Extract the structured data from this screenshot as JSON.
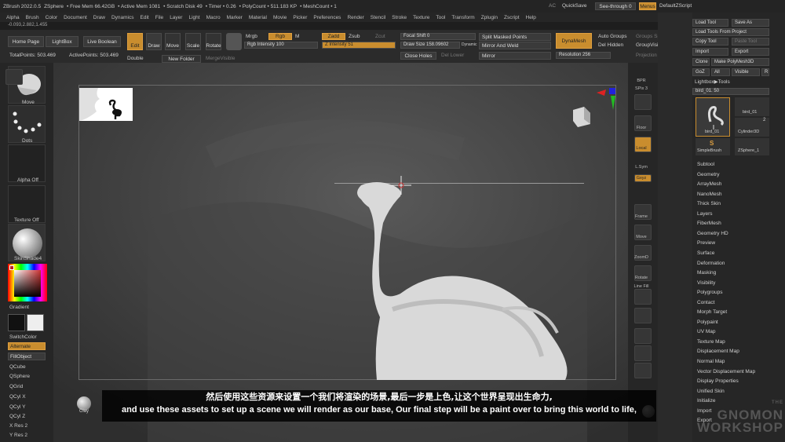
{
  "titlebar": {
    "items": [
      "ZBrush 2022.0.5",
      "ZSphere",
      "• Free Mem 66.42GB",
      "• Active Mem 1081",
      "• Scratch Disk 49",
      "• Timer • 0.26",
      "• PolyCount • 511.183 KP",
      "• MeshCount • 1"
    ],
    "ac": "AC",
    "quicksave": "QuickSave",
    "seethrough": "See-through  0",
    "menus": "Menus",
    "script": "DefaultZScript"
  },
  "menubar": [
    "Alpha",
    "Brush",
    "Color",
    "Document",
    "Draw",
    "Dynamics",
    "Edit",
    "File",
    "Layer",
    "Light",
    "Macro",
    "Marker",
    "Material",
    "Movie",
    "Picker",
    "Preferences",
    "Render",
    "Stencil",
    "Stroke",
    "Texture",
    "Tool",
    "Transform",
    "Zplugin",
    "Zscript",
    "Help"
  ],
  "coords": "-0.093,2.882,1.455",
  "toolrow": {
    "home": "Home Page",
    "lightbox": "LightBox",
    "liveboolean": "Live Boolean",
    "edit": "Edit",
    "draw": "Draw",
    "move": "Move",
    "scale": "Scale",
    "rotate": "Rotate",
    "mrgb": "Mrgb",
    "rgb": "Rgb",
    "m": "M",
    "rgb_intensity": "Rgb Intensity 100",
    "zadd": "Zadd",
    "zsub": "Zsub",
    "zcut": "Zcut",
    "z_intensity": "Z Intensity 51",
    "focal_shift": "Focal Shift 0",
    "draw_size": "Draw Size 158.09602",
    "dynamic": "Dynamic",
    "close_holes": "Close Holes",
    "del_lower": "Del Lower",
    "split_masked": "Split Masked Points",
    "mirror_weld": "Mirror And Weld",
    "mirror": "Mirror",
    "dynamesh": "DynaMesh",
    "resolution": "Resolution 256",
    "auto_groups": "Auto Groups",
    "del_hidden": "Del Hidden",
    "groups_split": "Groups Split",
    "group_visible": "GroupVisible",
    "projection_shell": "Projection Shell",
    "totalpoints": "TotalPoints: 503.469",
    "activepoints": "ActivePoints: 503.469",
    "double": "Double",
    "new_folder": "New Folder",
    "merge_visible": "MergeVisible"
  },
  "leftshelf": {
    "move": "Move",
    "dots": "Dots",
    "alpha_off": "Alpha Off",
    "texture_off": "Texture Off",
    "skinshade": "SkinShade4",
    "gradient": "Gradient",
    "switchcolor": "SwitchColor",
    "alternate": "Alternate",
    "fillobject": "FillObject",
    "qcube": "QCube",
    "qsphere": "QSphere",
    "qgrid": "QGrid",
    "qcylx": "QCyl X",
    "qcyly": "QCyl Y",
    "qcylz": "QCyl Z",
    "xres": "X Res 2",
    "yres": "Y Res 2"
  },
  "bottomshelf": {
    "clay": "Clay",
    "move": "Move",
    "backfacemask": "BackfaceMask",
    "accucurve": "AccuC...",
    "crease": "Crease",
    "ucrease": "UnCrease"
  },
  "rightshelf": [
    "BPR",
    "SPix 3",
    "Scroll",
    "Zoom",
    "Actual",
    "AAHalf",
    "Persp",
    "Floor",
    "Local",
    "L.Sym",
    "Gxyz",
    "Frame",
    "Move",
    "ZoomD",
    "Rotate",
    "Line Fill",
    "PolyF",
    "Transp",
    "Ghost",
    "Solo",
    "Xpose"
  ],
  "toolpanel": {
    "load_tool": "Load Tool",
    "save_as": "Save As",
    "load_from_project": "Load Tools From Project",
    "copy_tool": "Copy Tool",
    "paste_tool": "Paste Tool",
    "import": "Import",
    "export": "Export",
    "clone": "Clone",
    "make_polymesh": "Make PolyMesh3D",
    "goz": "GoZ",
    "all": "All",
    "visible": "Visible",
    "r": "R",
    "lightbox_tools": "Lightbox▶Tools",
    "current": "bird_01. 50",
    "thumbs": [
      "bird_01",
      "bird_01",
      "SimpleBrush",
      "Cylinder3D",
      "ZSphere_1"
    ],
    "num": "2"
  },
  "toolmenu": [
    "Subtool",
    "Geometry",
    "ArrayMesh",
    "NanoMesh",
    "Thick Skin",
    "Layers",
    "FiberMesh",
    "Geometry HD",
    "Preview",
    "Surface",
    "Deformation",
    "Masking",
    "Visibility",
    "Polygroups",
    "Contact",
    "Morph Target",
    "Polypaint",
    "UV Map",
    "Texture Map",
    "Displacement Map",
    "Normal Map",
    "Vector Displacement Map",
    "Display Properties",
    "Unified Skin",
    "Initialize",
    "Import",
    "Export"
  ],
  "subtitles": {
    "cn": "然后使用这些资源来设置一个我们将渲染的场景,最后一步是上色,让这个世界呈现出生命力,",
    "en": "and use these assets to set up a scene we will render as our base, Our final step will be a paint over to bring this world to life,"
  },
  "watermark": {
    "line1": "THE",
    "line2": "GNOMON",
    "line3": "WORKSHOP"
  },
  "colors": {
    "accent": "#c98d2e",
    "panel": "#262626",
    "canvas": "#3b3b3b"
  }
}
